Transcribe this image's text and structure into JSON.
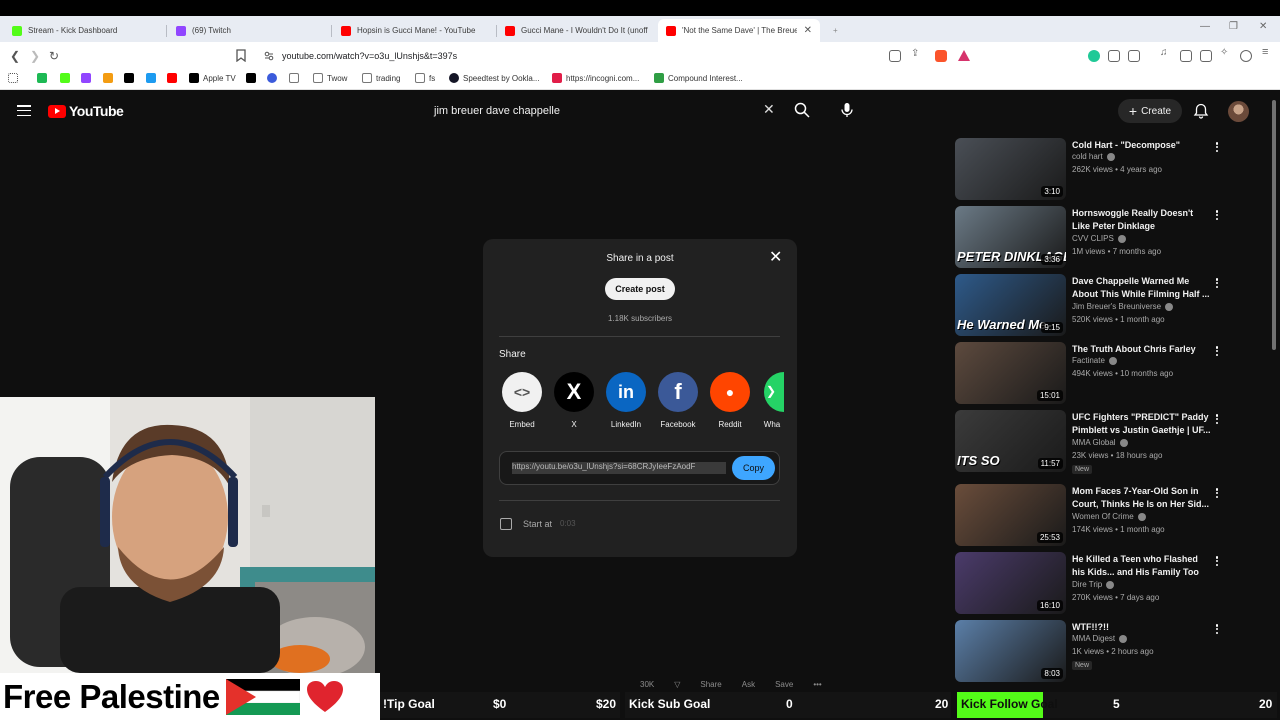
{
  "browser": {
    "tabs": [
      {
        "title": "Stream - Kick Dashboard",
        "favicon_color": "#53fc18",
        "active": false
      },
      {
        "title": "(69) Twitch",
        "favicon_color": "#9146ff",
        "active": false
      },
      {
        "title": "Hopsin is Gucci Mane! - YouTube",
        "favicon_color": "#ff0000",
        "active": false
      },
      {
        "title": "Gucci Mane - I Wouldn't Do It (unoff",
        "favicon_color": "#ff0000",
        "active": false
      },
      {
        "title": "'Not the Same Dave' | The Breue",
        "favicon_color": "#ff0000",
        "active": true
      }
    ],
    "new_tab_label": "+",
    "url": "youtube.com/watch?v=o3u_lUnshjs&t=397s",
    "bookmarks": [
      {
        "label": "",
        "color": "#1db954"
      },
      {
        "label": "",
        "color": "#53fc18"
      },
      {
        "label": "",
        "color": "#9146ff"
      },
      {
        "label": "",
        "color": "#f39c12"
      },
      {
        "label": "",
        "color": "#000000"
      },
      {
        "label": "",
        "color": "#1d9bf0"
      },
      {
        "label": "",
        "color": "#ff0000"
      },
      {
        "label": "Apple TV",
        "color": "#000000"
      },
      {
        "label": "",
        "color": "#000000"
      },
      {
        "label": "",
        "color": "#3b5bdb"
      },
      {
        "label": "",
        "color": "#888888"
      },
      {
        "label": "Twow",
        "color": "#888888"
      },
      {
        "label": "trading",
        "color": "#888888"
      },
      {
        "label": "fs",
        "color": "#888888"
      },
      {
        "label": "Speedtest by Ookla...",
        "color": "#141526"
      },
      {
        "label": "https://incogni.com...",
        "color": "#e11d48"
      },
      {
        "label": "Compound Interest...",
        "color": "#2f9e44"
      }
    ]
  },
  "youtube": {
    "logo_text": "YouTube",
    "search_value": "jim breuer dave chappelle",
    "create_label": "Create",
    "sidebar_videos": [
      {
        "title": "Cold Hart - \"Decompose\"",
        "channel": "cold hart",
        "meta": "262K views • 4 years ago",
        "duration": "3:10",
        "thumb": "#4a4f56",
        "new": ""
      },
      {
        "title": "Hornswoggle Really Doesn't Like Peter Dinklage",
        "channel": "CVV CLIPS",
        "meta": "1M views • 7 months ago",
        "duration": "3:36",
        "thumb": "#6b7a86",
        "new": "",
        "overlay": "PETER DINKLAGE"
      },
      {
        "title": "Dave Chappelle Warned Me About This While Filming Half ...",
        "channel": "Jim Breuer's Breuniverse",
        "meta": "520K views • 1 month ago",
        "duration": "9:15",
        "thumb": "#2e5a8a",
        "new": "",
        "overlay": "He Warned Me"
      },
      {
        "title": "The Truth About Chris Farley",
        "channel": "Factinate",
        "meta": "494K views • 10 months ago",
        "duration": "15:01",
        "thumb": "#5d4a3e",
        "new": ""
      },
      {
        "title": "UFC Fighters \"PREDICT\" Paddy Pimblett vs Justin Gaethje | UF...",
        "channel": "MMA Global",
        "meta": "23K views • 18 hours ago",
        "duration": "11:57",
        "thumb": "#3b3b3b",
        "new": "New",
        "overlay": "ITS SO"
      },
      {
        "title": "Mom Faces 7-Year-Old Son in Court, Thinks He Is on Her Sid...",
        "channel": "Women Of Crime",
        "meta": "174K views • 1 month ago",
        "duration": "25:53",
        "thumb": "#6a4d3b",
        "new": ""
      },
      {
        "title": "He Killed a Teen who Flashed his Kids... and His Family Too",
        "channel": "Dire Trip",
        "meta": "270K views • 7 days ago",
        "duration": "16:10",
        "thumb": "#4b3b6b",
        "new": ""
      },
      {
        "title": "WTF!!?!!",
        "channel": "MMA Digest",
        "meta": "1K views • 2 hours ago",
        "duration": "8:03",
        "thumb": "#5b7fa8",
        "new": "New"
      }
    ],
    "action_bar": [
      "30K",
      "Share",
      "Ask",
      "Save"
    ]
  },
  "share_dialog": {
    "title": "Share in a post",
    "create_post_label": "Create post",
    "subscribers": "1.18K subscribers",
    "share_label": "Share",
    "targets": [
      {
        "label": "Embed",
        "bg": "#f1f1f1",
        "glyph": "<>",
        "fg": "#555555"
      },
      {
        "label": "X",
        "bg": "#000000",
        "glyph": "X",
        "fg": "#ffffff"
      },
      {
        "label": "LinkedIn",
        "bg": "#0a66c2",
        "glyph": "in",
        "fg": "#ffffff"
      },
      {
        "label": "Facebook",
        "bg": "#3b5998",
        "glyph": "f",
        "fg": "#ffffff"
      },
      {
        "label": "Reddit",
        "bg": "#ff4500",
        "glyph": "●",
        "fg": "#ffffff"
      },
      {
        "label": "Wha",
        "bg": "#25d366",
        "glyph": "",
        "fg": "#ffffff"
      }
    ],
    "link": "https://youtu.be/o3u_lUnshjs?si=68CRJyIeeFzAodF",
    "copy_label": "Copy",
    "start_at_label": "Start at",
    "start_time": "0:03"
  },
  "stream_overlay": {
    "banner_text": "Free Palestine",
    "goals": [
      {
        "label": "!Tip Goal",
        "current": "$0",
        "target": "$20",
        "progress": 0,
        "fill": "#53fc18"
      },
      {
        "label": "Kick Sub Goal",
        "current": "0",
        "target": "20",
        "progress": 0,
        "fill": "#53fc18"
      },
      {
        "label": "Kick Follow Goal",
        "current": "5",
        "target": "20",
        "progress": 0.25,
        "fill": "#53fc18"
      }
    ]
  }
}
